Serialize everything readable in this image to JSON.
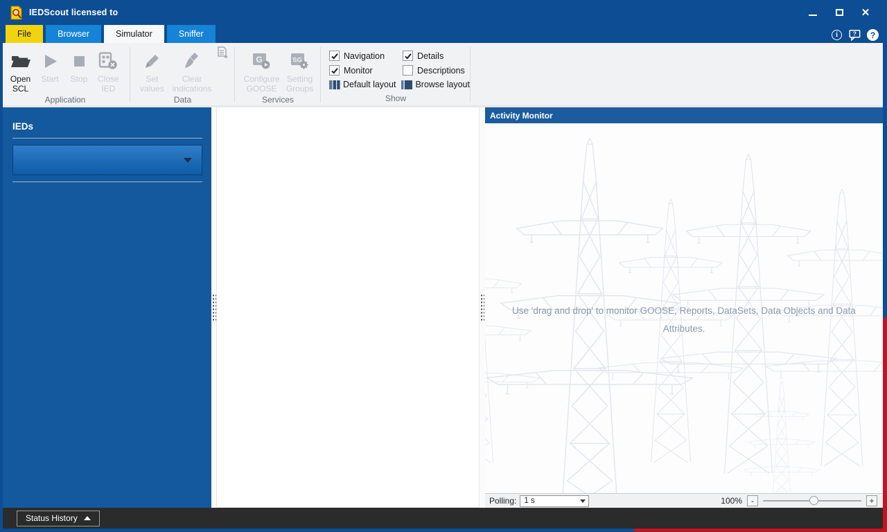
{
  "titlebar": {
    "title": "IEDScout licensed to"
  },
  "tabs": {
    "items": [
      {
        "label": "File"
      },
      {
        "label": "Browser"
      },
      {
        "label": "Simulator"
      },
      {
        "label": "Sniffer"
      }
    ]
  },
  "ribbon": {
    "groups": {
      "application": {
        "label": "Application",
        "buttons": [
          {
            "label": "Open\nSCL",
            "enabled": true
          },
          {
            "label": "Start",
            "enabled": false
          },
          {
            "label": "Stop",
            "enabled": false
          },
          {
            "label": "Close\nIED",
            "enabled": false
          }
        ]
      },
      "data": {
        "label": "Data",
        "buttons": [
          {
            "label": "Set\nvalues",
            "enabled": false
          },
          {
            "label": "Clear\nindications",
            "enabled": false
          }
        ]
      },
      "services": {
        "label": "Services",
        "buttons": [
          {
            "label": "Configure\nGOOSE",
            "enabled": false
          },
          {
            "label": "Setting\nGroups",
            "enabled": false
          }
        ]
      },
      "show": {
        "label": "Show",
        "checkboxes": [
          {
            "label": "Navigation",
            "checked": true
          },
          {
            "label": "Details",
            "checked": true
          },
          {
            "label": "Monitor",
            "checked": true
          },
          {
            "label": "Descriptions",
            "checked": false
          }
        ],
        "layouts": [
          {
            "label": "Default layout"
          },
          {
            "label": "Browse layout"
          }
        ]
      }
    }
  },
  "sidebar": {
    "title": "IEDs",
    "ied_selector_value": ""
  },
  "activity_monitor": {
    "title": "Activity Monitor",
    "hint": "Use 'drag and drop' to monitor GOOSE, Reports, DataSets, Data Objects and Data Attributes.",
    "polling": {
      "label": "Polling:",
      "value": "1 s"
    },
    "zoom": {
      "value": "100%",
      "minus": "-",
      "plus": "+"
    }
  },
  "status_bar": {
    "toggle_label": "Status History"
  },
  "colors": {
    "title_blue": "#0D4D93",
    "tab_blue": "#1583D6",
    "file_yellow": "#F2D40E",
    "panel_blue": "#14599E",
    "header_blue": "#1B5B9E",
    "brand_red": "#BE1622"
  }
}
